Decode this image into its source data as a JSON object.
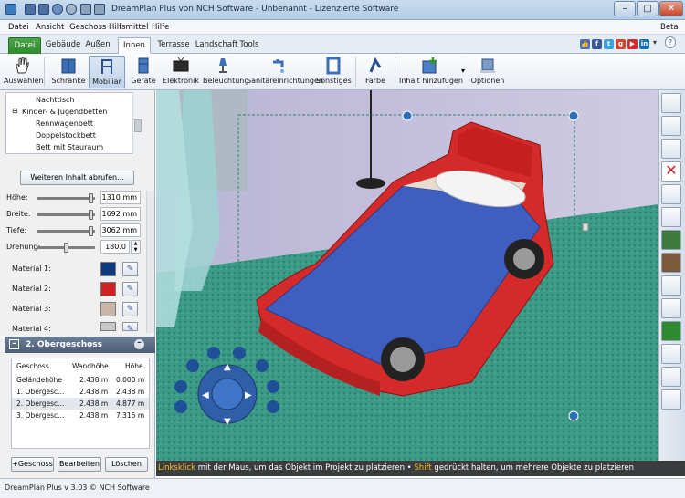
{
  "window": {
    "title": "DreamPlan Plus von NCH Software - Unbenannt - Lizenzierte Software"
  },
  "menu": [
    "Datei",
    "Ansicht",
    "Geschoss",
    "Hilfsmittel",
    "Hilfe"
  ],
  "menu_right": "Beta",
  "tabs": [
    "Datei",
    "Gebäude",
    "Außen",
    "Innen",
    "Terrasse",
    "Landschaft",
    "Tools"
  ],
  "active_tab": "Innen",
  "social_icons": [
    "like-icon",
    "facebook-icon",
    "twitter-icon",
    "google-plus-icon",
    "youtube-icon",
    "linkedin-icon"
  ],
  "toolbar": [
    {
      "label": "Auswählen",
      "icon": "hand-icon"
    },
    {
      "label": "Schränke",
      "icon": "cabinet-icon"
    },
    {
      "label": "Mobiliar",
      "icon": "chair-icon",
      "selected": true
    },
    {
      "label": "Geräte",
      "icon": "appliance-icon"
    },
    {
      "label": "Elektronik",
      "icon": "tv-icon"
    },
    {
      "label": "Beleuchtung",
      "icon": "lamp-icon"
    },
    {
      "label": "Sanitäreinrichtungen",
      "icon": "faucet-icon"
    },
    {
      "label": "Sonstiges",
      "icon": "frame-icon"
    },
    {
      "label": "Farbe",
      "icon": "paint-icon"
    },
    {
      "label": "Inhalt hinzufügen",
      "icon": "add-content-icon"
    },
    {
      "label": "Optionen",
      "icon": "options-icon"
    }
  ],
  "tree": {
    "items": [
      "Nachttisch",
      "Kinder- & Jugendbetten",
      "Rennwagenbett",
      "Doppelstockbett",
      "Bett mit Stauraum"
    ],
    "more_button": "Weiteren Inhalt abrufen..."
  },
  "dimensions": [
    {
      "label": "Höhe:",
      "value": "1310 mm",
      "level": 0.97
    },
    {
      "label": "Breite:",
      "value": "1692 mm",
      "level": 0.97
    },
    {
      "label": "Tiefe:",
      "value": "3062 mm",
      "level": 0.97
    },
    {
      "label": "Drehung:",
      "value": "180.0",
      "level": 0.5
    }
  ],
  "materials": [
    {
      "label": "Material 1:",
      "color": "#0f3a7d"
    },
    {
      "label": "Material 2:",
      "color": "#cf2323"
    },
    {
      "label": "Material 3:",
      "color": "#c9b6a8"
    },
    {
      "label": "Material 4:",
      "color": "#c7c7c7"
    }
  ],
  "floor_panel": {
    "title": "2. Obergeschoss",
    "headers": [
      "Geschoss",
      "Wandhöhe",
      "Höhe"
    ],
    "rows": [
      [
        "Geländehöhe",
        "2.438 m",
        "0.000 m"
      ],
      [
        "1. Obergesc...",
        "2.438 m",
        "2.438 m"
      ],
      [
        "2. Obergesc...",
        "2.438 m",
        "4.877 m"
      ],
      [
        "3. Obergesc...",
        "2.438 m",
        "7.315 m"
      ]
    ],
    "buttons": [
      "+Geschoss",
      "Bearbeiten",
      "Löschen"
    ]
  },
  "hint": {
    "a": "Linksklick",
    "b": " mit der Maus, um das Objekt im Projekt zu platzieren • ",
    "c": "Shift",
    "d": " gedrückt halten, um mehrere Objekte zu platzieren"
  },
  "status": "DreamPlan Plus v 3.03 © NCH Software",
  "colors": {
    "carpet": "#3a9a85",
    "bed_frame": "#d42a2a",
    "mattress": "#3e5fc0",
    "wall": "#c5c1dd"
  }
}
